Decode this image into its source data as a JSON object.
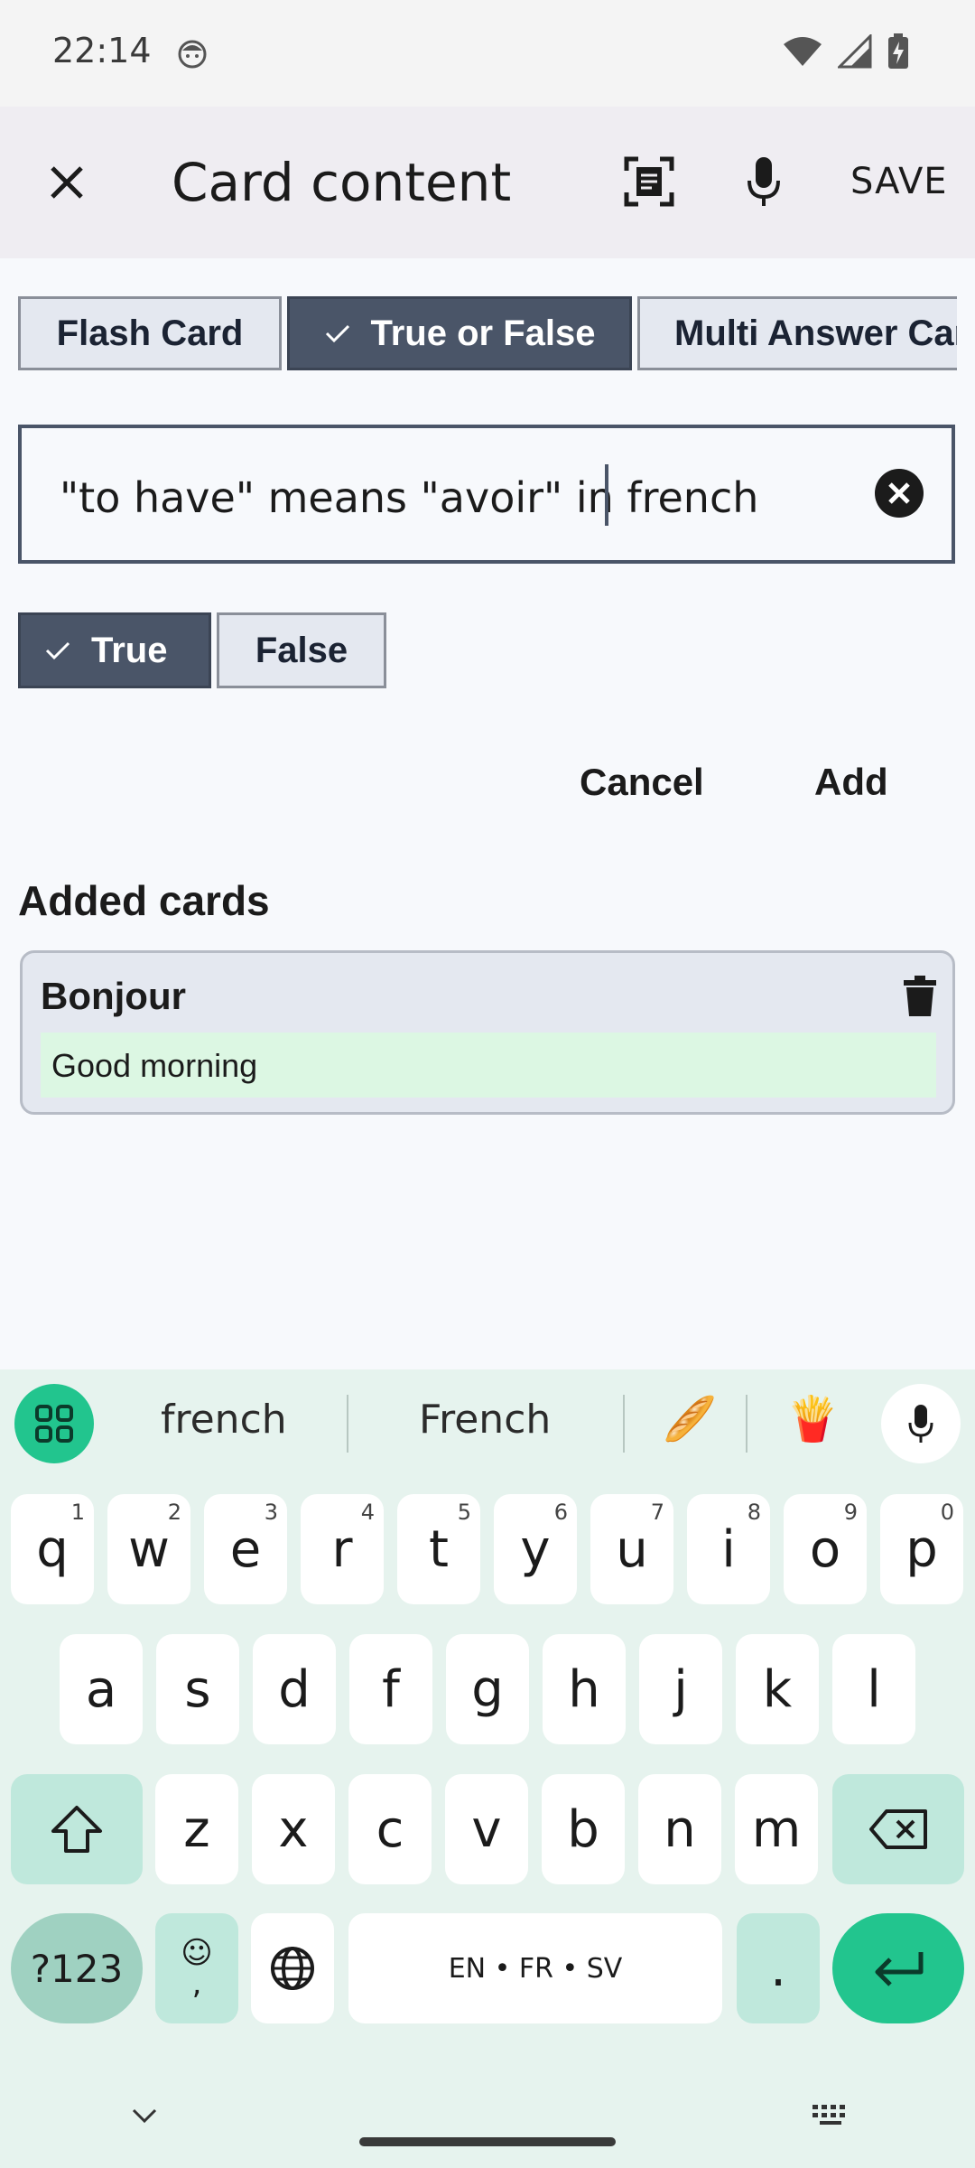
{
  "status": {
    "time": "22:14"
  },
  "app_bar": {
    "title": "Card content",
    "save_label": "SAVE"
  },
  "card_types": [
    {
      "label": "Flash Card",
      "selected": false
    },
    {
      "label": "True or False",
      "selected": true
    },
    {
      "label": "Multi Answer Card",
      "selected": false
    }
  ],
  "statement_input": {
    "value": "\"to have\" means \"avoir\" in french"
  },
  "answers": [
    {
      "label": "True",
      "selected": true
    },
    {
      "label": "False",
      "selected": false
    }
  ],
  "actions": {
    "cancel_label": "Cancel",
    "add_label": "Add"
  },
  "added_cards": {
    "heading": "Added cards",
    "items": [
      {
        "front": "Bonjour",
        "back": "Good morning"
      }
    ]
  },
  "keyboard": {
    "suggestions": [
      "french",
      "French"
    ],
    "emoji_suggestions": [
      "🥖",
      "🍟"
    ],
    "row1": [
      {
        "k": "q",
        "h": "1"
      },
      {
        "k": "w",
        "h": "2"
      },
      {
        "k": "e",
        "h": "3"
      },
      {
        "k": "r",
        "h": "4"
      },
      {
        "k": "t",
        "h": "5"
      },
      {
        "k": "y",
        "h": "6"
      },
      {
        "k": "u",
        "h": "7"
      },
      {
        "k": "i",
        "h": "8"
      },
      {
        "k": "o",
        "h": "9"
      },
      {
        "k": "p",
        "h": "0"
      }
    ],
    "row2": [
      "a",
      "s",
      "d",
      "f",
      "g",
      "h",
      "j",
      "k",
      "l"
    ],
    "row3": [
      "z",
      "x",
      "c",
      "v",
      "b",
      "n",
      "m"
    ],
    "symbols_label": "?123",
    "emoji_key_top": "☺",
    "emoji_key_bottom": ",",
    "space_label": "EN • FR • SV",
    "period_label": "."
  },
  "colors": {
    "accent": "#4a5568",
    "keyboard_accent": "#22c58e",
    "answer_bg": "#dcf7e3"
  }
}
